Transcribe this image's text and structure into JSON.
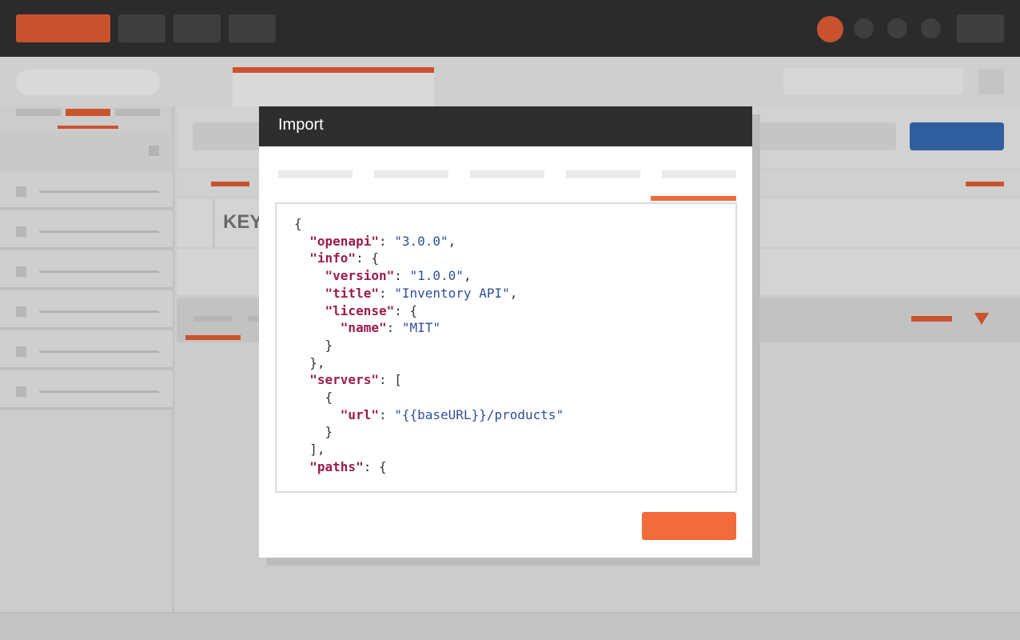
{
  "modal": {
    "title": "Import",
    "tabs": [
      "",
      "",
      "",
      "",
      ""
    ],
    "active_tab_index": 4
  },
  "background": {
    "column_header_text": "KEY"
  },
  "editor": {
    "lines": [
      [
        {
          "t": "p",
          "v": "{"
        }
      ],
      [
        {
          "t": "p",
          "v": "  "
        },
        {
          "t": "k",
          "v": "\"openapi\""
        },
        {
          "t": "p",
          "v": ": "
        },
        {
          "t": "s",
          "v": "\"3.0.0\""
        },
        {
          "t": "p",
          "v": ","
        }
      ],
      [
        {
          "t": "p",
          "v": "  "
        },
        {
          "t": "k",
          "v": "\"info\""
        },
        {
          "t": "p",
          "v": ": {"
        }
      ],
      [
        {
          "t": "p",
          "v": "    "
        },
        {
          "t": "k",
          "v": "\"version\""
        },
        {
          "t": "p",
          "v": ": "
        },
        {
          "t": "s",
          "v": "\"1.0.0\""
        },
        {
          "t": "p",
          "v": ","
        }
      ],
      [
        {
          "t": "p",
          "v": "    "
        },
        {
          "t": "k",
          "v": "\"title\""
        },
        {
          "t": "p",
          "v": ": "
        },
        {
          "t": "s",
          "v": "\"Inventory API\""
        },
        {
          "t": "p",
          "v": ","
        }
      ],
      [
        {
          "t": "p",
          "v": "    "
        },
        {
          "t": "k",
          "v": "\"license\""
        },
        {
          "t": "p",
          "v": ": {"
        }
      ],
      [
        {
          "t": "p",
          "v": "      "
        },
        {
          "t": "k",
          "v": "\"name\""
        },
        {
          "t": "p",
          "v": ": "
        },
        {
          "t": "s",
          "v": "\"MIT\""
        }
      ],
      [
        {
          "t": "p",
          "v": "    }"
        }
      ],
      [
        {
          "t": "p",
          "v": "  },"
        }
      ],
      [
        {
          "t": "p",
          "v": "  "
        },
        {
          "t": "k",
          "v": "\"servers\""
        },
        {
          "t": "p",
          "v": ": ["
        }
      ],
      [
        {
          "t": "p",
          "v": "    {"
        }
      ],
      [
        {
          "t": "p",
          "v": "      "
        },
        {
          "t": "k",
          "v": "\"url\""
        },
        {
          "t": "p",
          "v": ": "
        },
        {
          "t": "s",
          "v": "\"{{baseURL}}/products\""
        }
      ],
      [
        {
          "t": "p",
          "v": "    }"
        }
      ],
      [
        {
          "t": "p",
          "v": "  ],"
        }
      ],
      [
        {
          "t": "p",
          "v": "  "
        },
        {
          "t": "k",
          "v": "\"paths\""
        },
        {
          "t": "p",
          "v": ": {"
        }
      ]
    ]
  },
  "colors": {
    "accent": "#f26b38",
    "brand_blue": "#2f5f9e",
    "topbar": "#2b2b2b",
    "json_key": "#9b1b4f",
    "json_string": "#2f4f9a"
  }
}
